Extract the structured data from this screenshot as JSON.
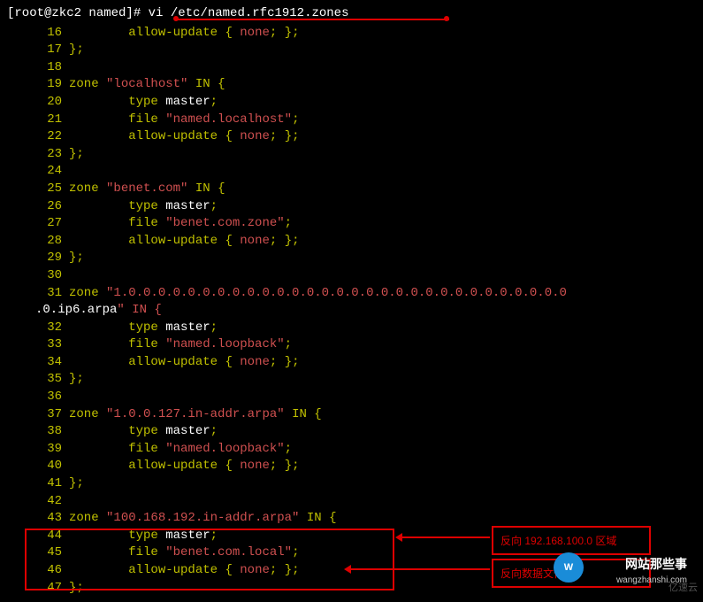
{
  "prompt": {
    "user_host": "[root@zkc2 named]#",
    "command": "vi /etc/named.rfc1912.zones"
  },
  "lines": [
    {
      "n": "16",
      "text": "        allow-update { none; };"
    },
    {
      "n": "17",
      "text": "};"
    },
    {
      "n": "18",
      "text": ""
    },
    {
      "n": "19",
      "text": "zone \"localhost\" IN {"
    },
    {
      "n": "20",
      "text": "        type master;"
    },
    {
      "n": "21",
      "text": "        file \"named.localhost\";"
    },
    {
      "n": "22",
      "text": "        allow-update { none; };"
    },
    {
      "n": "23",
      "text": "};"
    },
    {
      "n": "24",
      "text": ""
    },
    {
      "n": "25",
      "text": "zone \"benet.com\" IN {"
    },
    {
      "n": "26",
      "text": "        type master;"
    },
    {
      "n": "27",
      "text": "        file \"benet.com.zone\";"
    },
    {
      "n": "28",
      "text": "        allow-update { none; };"
    },
    {
      "n": "29",
      "text": "};"
    },
    {
      "n": "30",
      "text": ""
    },
    {
      "n": "31",
      "text": "zone \"1.0.0.0.0.0.0.0.0.0.0.0.0.0.0.0.0.0.0.0.0.0.0.0.0.0.0.0.0.0.0.0.ip6.arpa\" IN {",
      "wrap": true
    },
    {
      "n": "32",
      "text": "        type master;"
    },
    {
      "n": "33",
      "text": "        file \"named.loopback\";"
    },
    {
      "n": "34",
      "text": "        allow-update { none; };"
    },
    {
      "n": "35",
      "text": "};"
    },
    {
      "n": "36",
      "text": ""
    },
    {
      "n": "37",
      "text": "zone \"1.0.0.127.in-addr.arpa\" IN {"
    },
    {
      "n": "38",
      "text": "        type master;"
    },
    {
      "n": "39",
      "text": "        file \"named.loopback\";"
    },
    {
      "n": "40",
      "text": "        allow-update { none; };"
    },
    {
      "n": "41",
      "text": "};"
    },
    {
      "n": "42",
      "text": ""
    },
    {
      "n": "43",
      "text": "zone \"100.168.192.in-addr.arpa\" IN {"
    },
    {
      "n": "44",
      "text": "        type master;"
    },
    {
      "n": "45",
      "text": "        file \"benet.com.local\";",
      "cursor_at": 30
    },
    {
      "n": "46",
      "text": "        allow-update { none; };"
    },
    {
      "n": "47",
      "text": "};"
    }
  ],
  "annotations": {
    "anno1": "反向 192.168.100.0 区域",
    "anno2": "反向数据文件名"
  },
  "watermark": {
    "site_cn": "网站那些事",
    "site_en": "wangzhanshi.com",
    "corner": "亿速云"
  }
}
